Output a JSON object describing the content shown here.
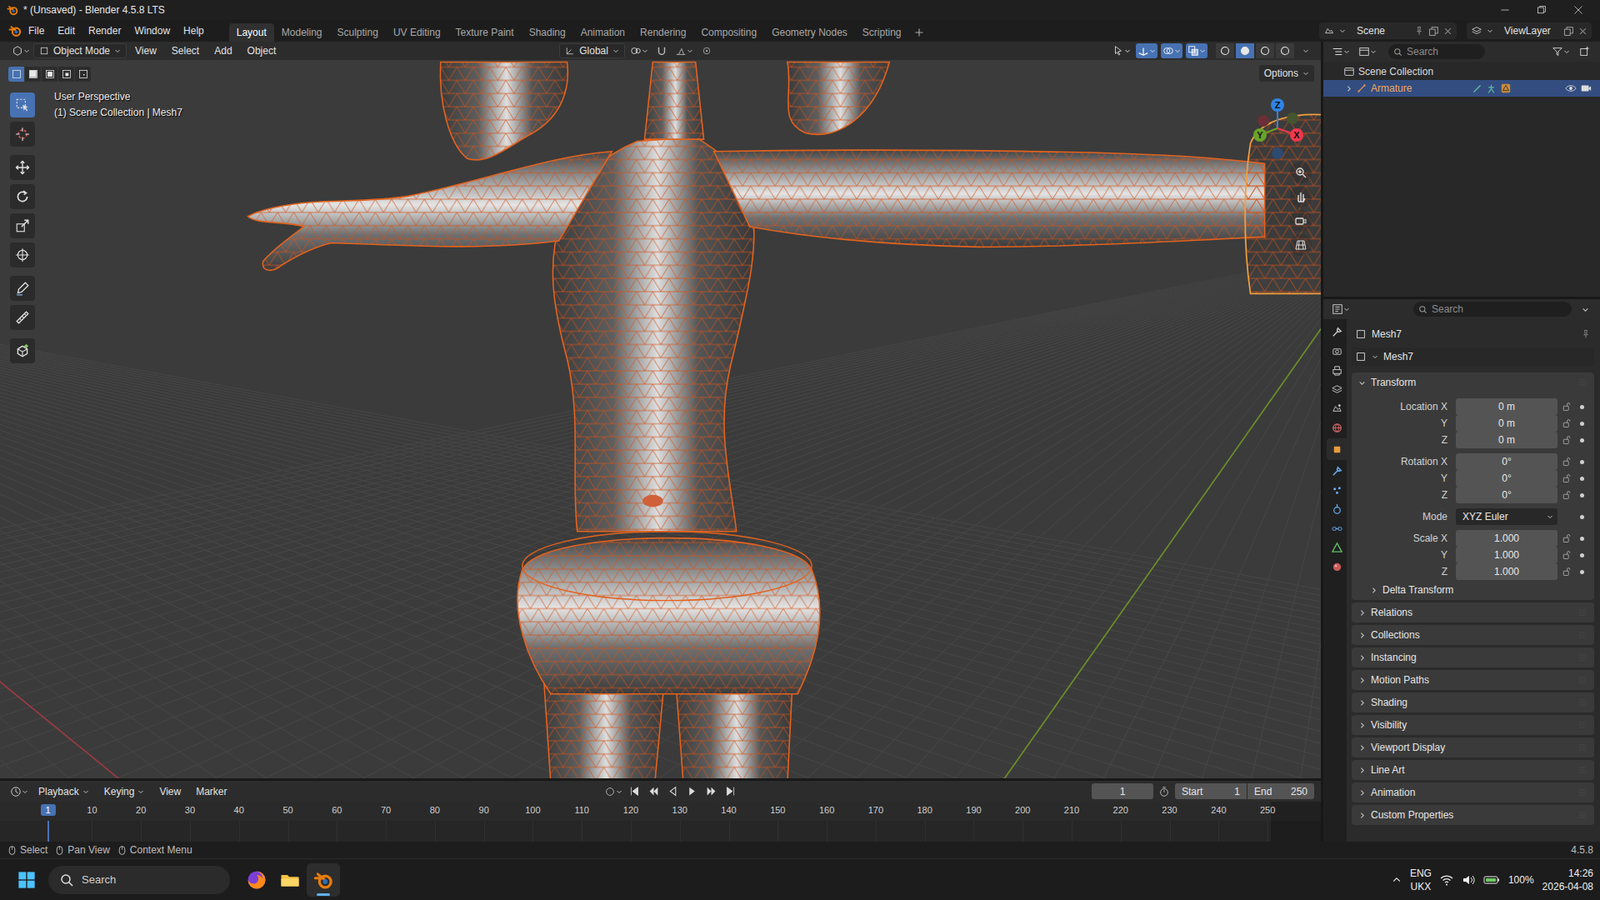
{
  "window": {
    "title": "* (Unsaved) - Blender 4.5.8 LTS"
  },
  "menus": [
    "File",
    "Edit",
    "Render",
    "Window",
    "Help"
  ],
  "workspaces": [
    {
      "label": "Layout",
      "selected": true
    },
    {
      "label": "Modeling",
      "selected": false
    },
    {
      "label": "Sculpting",
      "selected": false
    },
    {
      "label": "UV Editing",
      "selected": false
    },
    {
      "label": "Texture Paint",
      "selected": false
    },
    {
      "label": "Shading",
      "selected": false
    },
    {
      "label": "Animation",
      "selected": false
    },
    {
      "label": "Rendering",
      "selected": false
    },
    {
      "label": "Compositing",
      "selected": false
    },
    {
      "label": "Geometry Nodes",
      "selected": false
    },
    {
      "label": "Scripting",
      "selected": false
    }
  ],
  "scene": {
    "name": "Scene",
    "view_layer": "ViewLayer"
  },
  "viewport": {
    "mode": "Object Mode",
    "menus": [
      "View",
      "Select",
      "Add",
      "Object"
    ],
    "orientation": "Global",
    "options": "Options",
    "info": [
      "User Perspective",
      "(1) Scene Collection | Mesh7"
    ],
    "select_modes": [
      {
        "selected": true
      },
      {
        "selected": false
      },
      {
        "selected": false
      },
      {
        "selected": false
      },
      {
        "selected": false
      }
    ],
    "tools": [
      {
        "selected": true
      },
      {
        "selected": false
      },
      {
        "selected": false
      },
      {
        "selected": false
      },
      {
        "selected": false
      },
      {
        "selected": false
      },
      {
        "selected": false
      },
      {
        "selected": false
      },
      {
        "selected": false
      }
    ],
    "toggles": [
      {
        "selected": false
      },
      {
        "selected": true
      },
      {
        "selected": true
      },
      {
        "selected": true
      }
    ],
    "shading_modes": [
      {
        "selected": false
      },
      {
        "selected": true
      },
      {
        "selected": false
      },
      {
        "selected": false
      }
    ],
    "gizmo": [
      {
        "label": "Z",
        "color": "#2f84e3"
      },
      {
        "label": "Y",
        "color": "#6ba32a"
      },
      {
        "label": "X",
        "color": "#f0384e"
      }
    ]
  },
  "outliner": {
    "search": {
      "placeholder": "Search"
    },
    "root": "Scene Collection",
    "items": [
      {
        "name": "Armature",
        "selected": true,
        "expanded": false,
        "visible": true
      }
    ]
  },
  "properties": {
    "search": {
      "placeholder": "Search"
    },
    "tabs": [
      {
        "selected": false
      },
      {
        "selected": false
      },
      {
        "selected": false
      },
      {
        "selected": false
      },
      {
        "selected": false
      },
      {
        "selected": false
      },
      {
        "selected": true
      },
      {
        "selected": false
      },
      {
        "selected": false
      },
      {
        "selected": false
      },
      {
        "selected": false
      },
      {
        "selected": false
      },
      {
        "selected": false
      }
    ],
    "object": "Mesh7",
    "datablock": "Mesh7",
    "transform": {
      "title": "Transform",
      "expanded": true,
      "groups": [
        [
          {
            "label": "Location X",
            "value": "0 m",
            "kind": "number",
            "locked": false
          },
          {
            "label": "Y",
            "value": "0 m",
            "kind": "number",
            "locked": false
          },
          {
            "label": "Z",
            "value": "0 m",
            "kind": "number",
            "locked": false
          }
        ],
        [
          {
            "label": "Rotation X",
            "value": "0°",
            "kind": "number",
            "locked": false
          },
          {
            "label": "Y",
            "value": "0°",
            "kind": "number",
            "locked": false
          },
          {
            "label": "Z",
            "value": "0°",
            "kind": "number",
            "locked": false
          }
        ],
        [
          {
            "label": "Mode",
            "value": "XYZ Euler",
            "kind": "dropdown",
            "locked": false
          }
        ],
        [
          {
            "label": "Scale X",
            "value": "1.000",
            "kind": "number",
            "locked": false
          },
          {
            "label": "Y",
            "value": "1.000",
            "kind": "number",
            "locked": false
          },
          {
            "label": "Z",
            "value": "1.000",
            "kind": "number",
            "locked": false
          }
        ]
      ],
      "subpanels": [
        {
          "label": "Delta Transform",
          "expanded": false
        }
      ]
    },
    "panels": [
      {
        "label": "Relations",
        "expanded": false
      },
      {
        "label": "Collections",
        "expanded": false
      },
      {
        "label": "Instancing",
        "expanded": false
      },
      {
        "label": "Motion Paths",
        "expanded": false
      },
      {
        "label": "Shading",
        "expanded": false
      },
      {
        "label": "Visibility",
        "expanded": false
      },
      {
        "label": "Viewport Display",
        "expanded": false
      },
      {
        "label": "Line Art",
        "expanded": false
      },
      {
        "label": "Animation",
        "expanded": false
      },
      {
        "label": "Custom Properties",
        "expanded": false
      }
    ]
  },
  "timeline": {
    "menus": [
      {
        "label": "Playback",
        "dropdown": true
      },
      {
        "label": "Keying",
        "dropdown": true
      },
      {
        "label": "View",
        "dropdown": false
      },
      {
        "label": "Marker",
        "dropdown": false
      }
    ],
    "current_frame": "1",
    "start_label": "Start",
    "start": "1",
    "end_label": "End",
    "end": "250",
    "ticks": [
      "10",
      "20",
      "30",
      "40",
      "50",
      "60",
      "70",
      "80",
      "90",
      "100",
      "110",
      "120",
      "130",
      "140",
      "150",
      "160",
      "170",
      "180",
      "190",
      "200",
      "210",
      "220",
      "230",
      "240",
      "250"
    ]
  },
  "status_bar": {
    "hints": [
      "Select",
      "Pan View",
      "Context Menu"
    ],
    "version": "4.5.8"
  },
  "taskbar": {
    "search": {
      "placeholder": "Search"
    },
    "apps": [
      {
        "active": false
      },
      {
        "active": false
      },
      {
        "active": true
      }
    ],
    "language": "ENG",
    "layout": "UKX",
    "battery": "100%",
    "time": "14:26",
    "date": "2026-04-08"
  }
}
